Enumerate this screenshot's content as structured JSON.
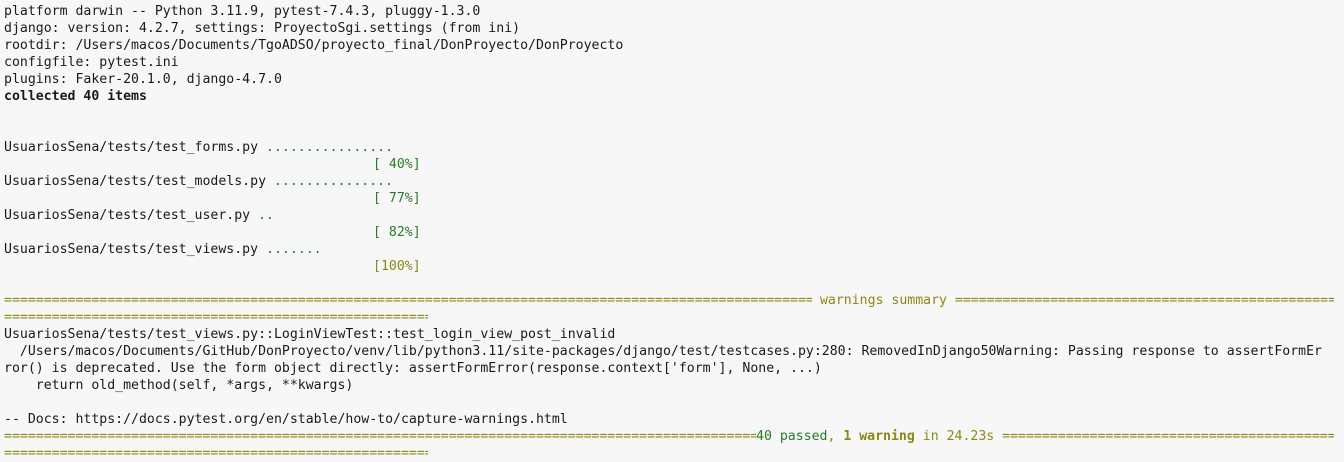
{
  "header": {
    "platform": "platform darwin -- Python 3.11.9, pytest-7.4.3, pluggy-1.3.0",
    "django": "django: version: 4.2.7, settings: ProyectoSgi.settings (from ini)",
    "rootdir": "rootdir: /Users/macos/Documents/TgoADSO/proyecto_final/DonProyecto/DonProyecto",
    "configfile": "configfile: pytest.ini",
    "plugins": "plugins: Faker-20.1.0, django-4.7.0",
    "collected": "collected 40 items"
  },
  "tests": [
    {
      "file": "UsuariosSena/tests/test_forms.py ",
      "dots": "................",
      "percent": "[ 40%]"
    },
    {
      "file": "UsuariosSena/tests/test_models.py ",
      "dots": "...............",
      "percent": "[ 77%]"
    },
    {
      "file": "UsuariosSena/tests/test_user.py ",
      "dots": "..",
      "percent": "[ 82%]"
    },
    {
      "file": "UsuariosSena/tests/test_views.py ",
      "dots": ".......",
      "percent": "[100%]"
    }
  ],
  "warnings": {
    "title": " warnings summary ",
    "test_id": "UsuariosSena/tests/test_views.py::LoginViewTest::test_login_view_post_invalid",
    "line1": "  /Users/macos/Documents/GitHub/DonProyecto/venv/lib/python3.11/site-packages/django/test/testcases.py:280: RemovedInDjango50Warning: Passing response to assertFormEr",
    "line2": "ror() is deprecated. Use the form object directly: assertFormError(response.context['form'], None, ...)",
    "line3": "    return old_method(self, *args, **kwargs)",
    "docs": "-- Docs: https://docs.pytest.org/en/stable/how-to/capture-warnings.html"
  },
  "summary": {
    "passed": "40 passed",
    "sep": ", ",
    "warning": "1 warning",
    "time": " in 24.23s "
  },
  "colors": {
    "background": "#f7f7f7",
    "text": "#1a1a1a",
    "green": "#247f24",
    "olive": "#8a8a10"
  }
}
